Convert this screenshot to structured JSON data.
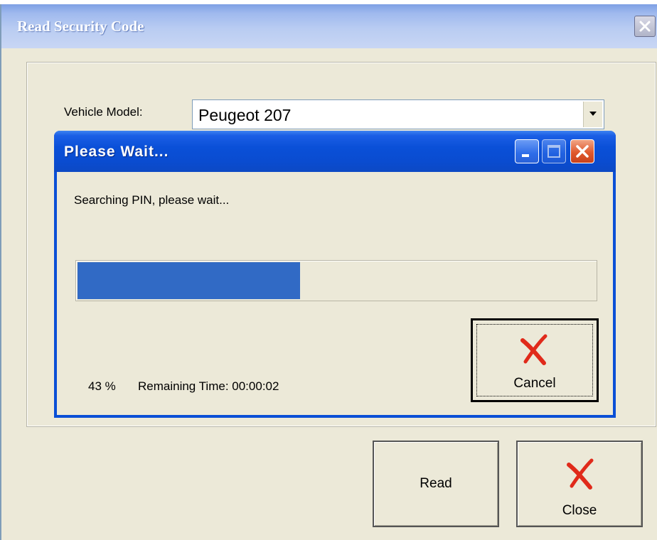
{
  "main_window": {
    "title": "Read Security Code",
    "vehicle_model_label": "Vehicle Model:",
    "vehicle_model_value": "Peugeot 207",
    "read_button": "Read",
    "close_button": "Close"
  },
  "dialog": {
    "title": "Please Wait...",
    "message": "Searching PIN, please wait...",
    "progress_percent": 43,
    "percent_text": "43 %",
    "remaining_text": "Remaining Time: 00:00:02",
    "cancel_button": "Cancel"
  },
  "icons": {
    "close_x": "red-x-icon",
    "dropdown": "chevron-down-icon"
  },
  "colors": {
    "progress_fill": "#316ac5",
    "titlebar_blue": "#0a4fd6",
    "window_face": "#ece9d8",
    "red_x": "#e02a1a"
  }
}
